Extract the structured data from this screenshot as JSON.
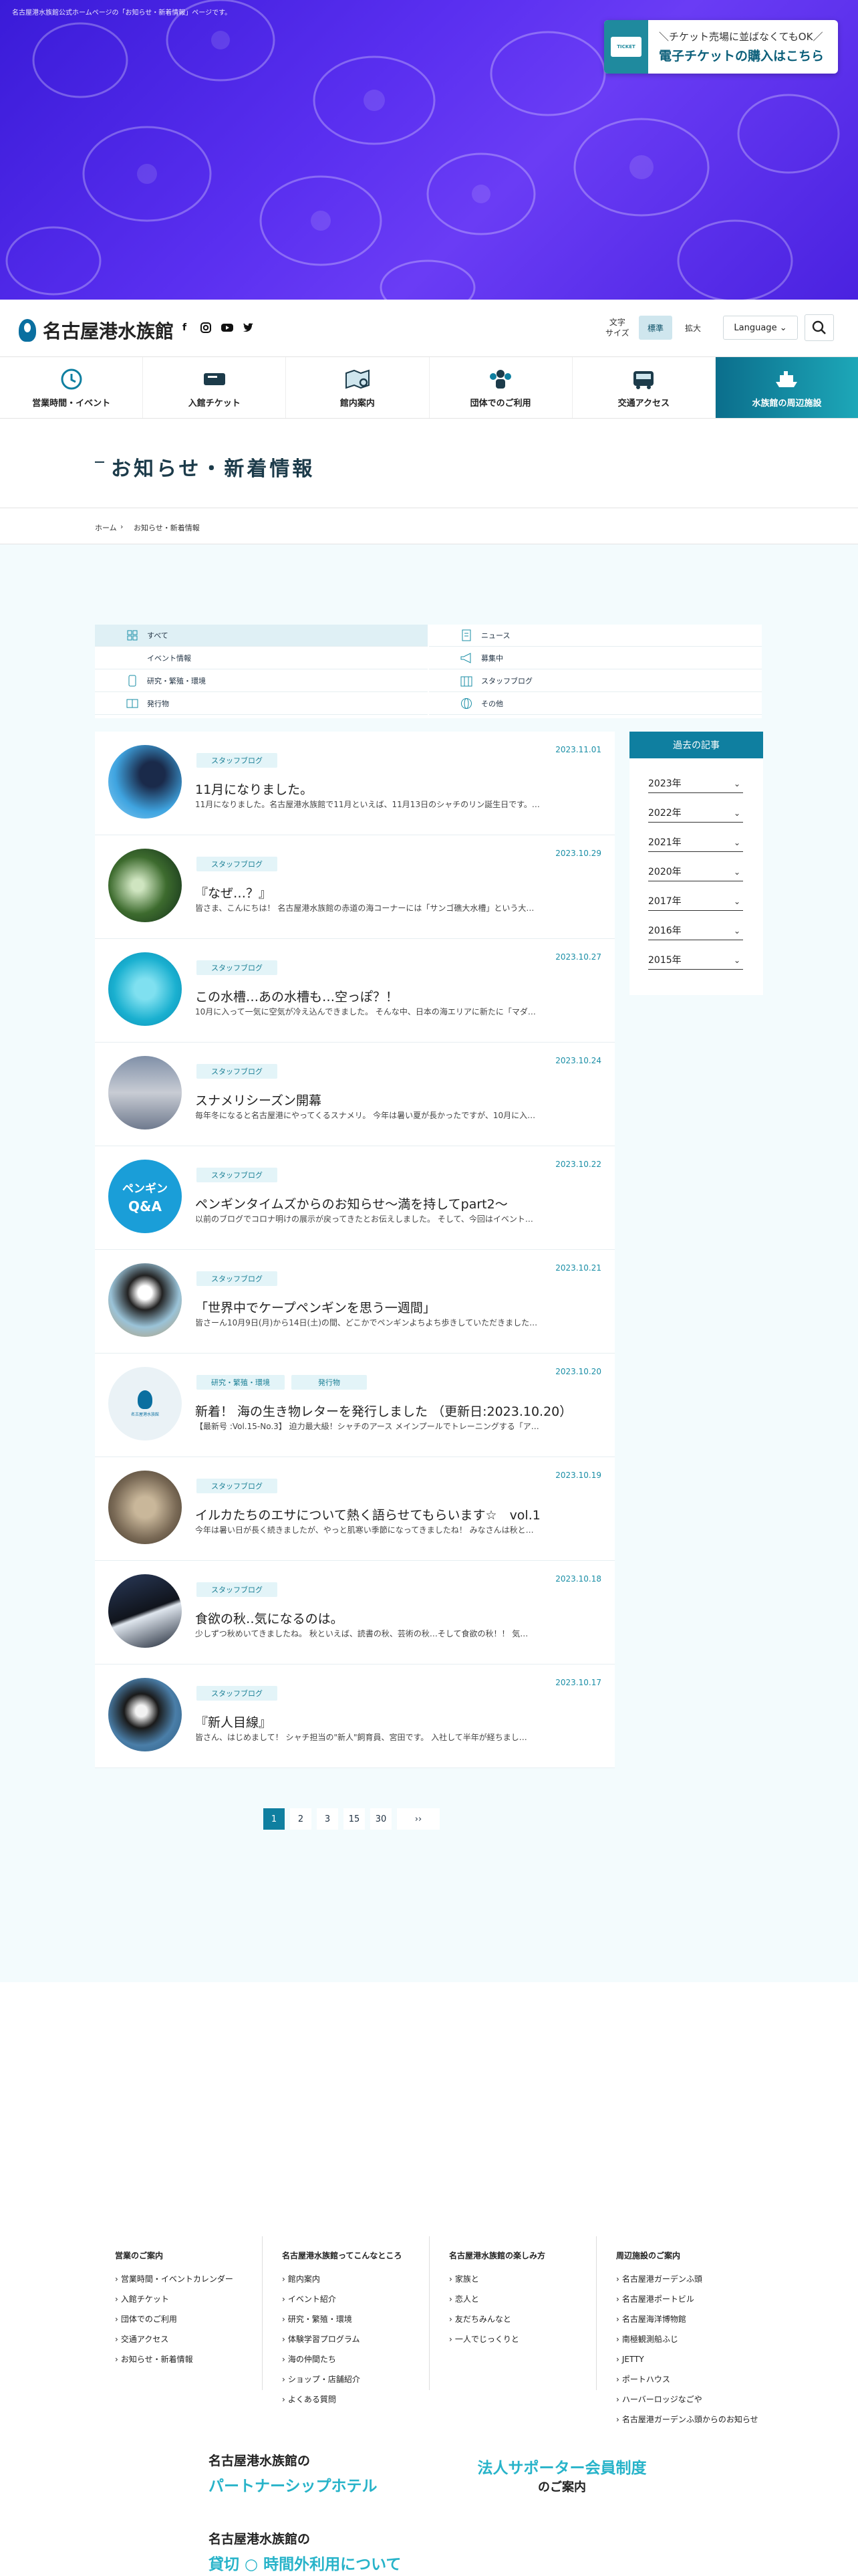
{
  "hero": {
    "note": "名古屋港水族館公式ホームページの「お知らせ・新着情報」ページです。",
    "ticket_card": "TICKET",
    "ticket_sub": "＼チケット売場に並ばなくてもOK／",
    "ticket_main": "電子チケットの購入はこちら"
  },
  "header": {
    "logo_text": "名古屋港水族館",
    "font_size_label_1": "文字",
    "font_size_label_2": "サイズ",
    "font_std": "標準",
    "font_big": "拡大",
    "language": "Language ⌄",
    "icons": [
      "facebook-icon",
      "instagram-icon",
      "youtube-icon",
      "twitter-icon",
      "search-icon"
    ]
  },
  "nav": [
    {
      "label": "営業時間・イベント",
      "icon": "clock-icon"
    },
    {
      "label": "入館チケット",
      "icon": "ticket-icon"
    },
    {
      "label": "館内案内",
      "icon": "map-icon"
    },
    {
      "label": "団体でのご利用",
      "icon": "group-icon"
    },
    {
      "label": "交通アクセス",
      "icon": "bus-icon"
    },
    {
      "label": "水族館の周辺施設",
      "icon": "ship-icon"
    }
  ],
  "page": {
    "title": "お知らせ・新着情報",
    "breadcrumb_home": "ホーム",
    "breadcrumb_sep": "›",
    "breadcrumb_current": "お知らせ・新着情報"
  },
  "categories": [
    {
      "label": "すべて",
      "icon": "grid-icon"
    },
    {
      "label": "ニュース",
      "icon": "document-icon"
    },
    {
      "label": "イベント情報",
      "icon": ""
    },
    {
      "label": "募集中",
      "icon": "megaphone-icon"
    },
    {
      "label": "研究・繁殖・環境",
      "icon": "phone-icon"
    },
    {
      "label": "スタッフブログ",
      "icon": "building-icon"
    },
    {
      "label": "発行物",
      "icon": "book-icon"
    },
    {
      "label": "その他",
      "icon": "globe-icon"
    }
  ],
  "articles": [
    {
      "date": "2023.11.01",
      "tags": [
        "スタッフブログ"
      ],
      "title": "11月になりました。",
      "excerpt": "11月になりました。名古屋港水族館で11月といえば、11月13日のシャチのリン誕生日です。…"
    },
    {
      "date": "2023.10.29",
      "tags": [
        "スタッフブログ"
      ],
      "title": "『なぜ…？』",
      "excerpt": "皆さま、こんにちは！ 名古屋港水族館の赤道の海コーナーには「サンゴ礁大水槽」という大…"
    },
    {
      "date": "2023.10.27",
      "tags": [
        "スタッフブログ"
      ],
      "title": "この水槽…あの水槽も…空っぽ？！",
      "excerpt": "10月に入って一気に空気が冷え込んできました。 そんな中、日本の海エリアに新たに「マダ…"
    },
    {
      "date": "2023.10.24",
      "tags": [
        "スタッフブログ"
      ],
      "title": "スナメリシーズン開幕",
      "excerpt": "毎年冬になると名古屋港にやってくるスナメリ。 今年は暑い夏が長かったですが、10月に入…"
    },
    {
      "date": "2023.10.22",
      "tags": [
        "スタッフブログ"
      ],
      "title": "ペンギンタイムズからのお知らせ〜満を持してpart2〜",
      "excerpt": "以前のブログでコロナ明けの展示が戻ってきたとお伝えしました。 そして、今回はイベント…",
      "thumb_text_1": "ペンギン",
      "thumb_text_2": "Q&A"
    },
    {
      "date": "2023.10.21",
      "tags": [
        "スタッフブログ"
      ],
      "title": "「世界中でケープペンギンを思う一週間」",
      "excerpt": "皆さーん10月9日(月)から14日(土)の間、どこかでペンギンよちよち歩きしていただきました…"
    },
    {
      "date": "2023.10.20",
      "tags": [
        "研究・繁殖・環境",
        "発行物"
      ],
      "title": "新着！ 海の生き物レターを発行しました （更新日:2023.10.20）",
      "excerpt": "【最新号 :Vol.15-No.3】 迫力最大級！シャチのアース メインプールでトレーニングする「ア…",
      "thumb_text_1": "名古屋港水族館"
    },
    {
      "date": "2023.10.19",
      "tags": [
        "スタッフブログ"
      ],
      "title": "イルカたちのエサについて熱く語らせてもらいます☆　vol.1",
      "excerpt": "今年は暑い日が長く続きましたが、やっと肌寒い季節になってきましたね！ みなさんは秋と…"
    },
    {
      "date": "2023.10.18",
      "tags": [
        "スタッフブログ"
      ],
      "title": "食欲の秋‥気になるのは。",
      "excerpt": "少しずつ秋めいてきましたね。 秋といえば、読書の秋、芸術の秋…そして食欲の秋！！ 気…"
    },
    {
      "date": "2023.10.17",
      "tags": [
        "スタッフブログ"
      ],
      "title": "『新人目線』",
      "excerpt": "皆さん、はじめまして！ シャチ担当の\"新人\"飼育員、宮田です。 入社して半年が経ちまし…"
    }
  ],
  "archive": {
    "heading": "過去の記事",
    "years": [
      "2023年",
      "2022年",
      "2021年",
      "2020年",
      "2017年",
      "2016年",
      "2015年"
    ],
    "chevron": "⌄"
  },
  "pager": [
    "1",
    "2",
    "3",
    "15",
    "30",
    "››"
  ],
  "footer": {
    "columns": [
      {
        "heading": "営業のご案内",
        "links": [
          "営業時間・イベントカレンダー",
          "入館チケット",
          "団体でのご利用",
          "交通アクセス",
          "お知らせ・新着情報"
        ]
      },
      {
        "heading": "名古屋港水族館ってこんなところ",
        "links": [
          "館内案内",
          "イベント紹介",
          "研究・繁殖・環境",
          "体験学習プログラム",
          "海の仲間たち",
          "ショップ・店舗紹介",
          "よくある質問"
        ]
      },
      {
        "heading": "名古屋港水族館の楽しみ方",
        "links": [
          "家族と",
          "恋人と",
          "友だちみんなと",
          "一人でじっくりと"
        ]
      },
      {
        "heading": "周辺施設のご案内",
        "links": [
          "名古屋港ガーデンふ頭",
          "名古屋港ポートビル",
          "名古屋海洋博物館",
          "南極観測船ふじ",
          "JETTY",
          "ポートハウス",
          "ハーバーロッジなごや",
          "名古屋港ガーデンふ頭からのお知らせ"
        ]
      }
    ],
    "promo1_small": "名古屋港水族館の",
    "promo1_big": "パートナーシップホテル",
    "promo2_big": "法人サポーター会員制度",
    "promo2_small": "のご案内",
    "promo3_small": "名古屋港水族館の",
    "promo3_big": "貸切 ○ 時間外利用について"
  },
  "colors": {
    "accent": "#0f7fa0",
    "tag_bg": "#e3f4f8",
    "content_bg": "#f3fbfd",
    "hero": "#4a22e0"
  }
}
